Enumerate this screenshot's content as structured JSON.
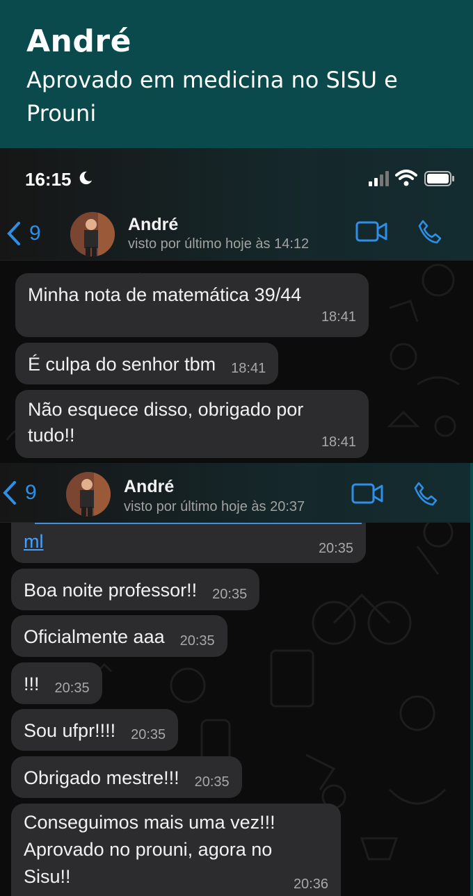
{
  "banner": {
    "name": "André",
    "subtitle": "Aprovado em medicina no SISU e Prouni"
  },
  "statusbar": {
    "time": "16:15"
  },
  "screenshot1": {
    "back_count": "9",
    "contact_name": "André",
    "contact_status": "visto por último hoje às 14:12",
    "messages": [
      {
        "text": "Minha nota de matemática 39/44",
        "time": "18:41"
      },
      {
        "text": "É culpa do senhor tbm",
        "time": "18:41"
      },
      {
        "text": "Não esquece disso, obrigado por tudo!!",
        "time": "18:41"
      }
    ]
  },
  "screenshot2": {
    "back_count": "9",
    "contact_name": "André",
    "contact_status": "visto por último hoje às 20:37",
    "messages": [
      {
        "text": "ml",
        "time": "20:35"
      },
      {
        "text": "Boa noite professor!!",
        "time": "20:35"
      },
      {
        "text": "Oficialmente aaa",
        "time": "20:35"
      },
      {
        "text": "!!!",
        "time": "20:35"
      },
      {
        "text": "Sou ufpr!!!!",
        "time": "20:35"
      },
      {
        "text": "Obrigado mestre!!!",
        "time": "20:35"
      },
      {
        "text": "Conseguimos mais uma vez!!! Aprovado no prouni, agora no Sisu!!",
        "time": "20:36"
      }
    ]
  },
  "colors": {
    "banner_bg": "#0b4a4c",
    "accent_blue": "#2f8fe6",
    "bubble_bg": "#2c2c2e"
  }
}
